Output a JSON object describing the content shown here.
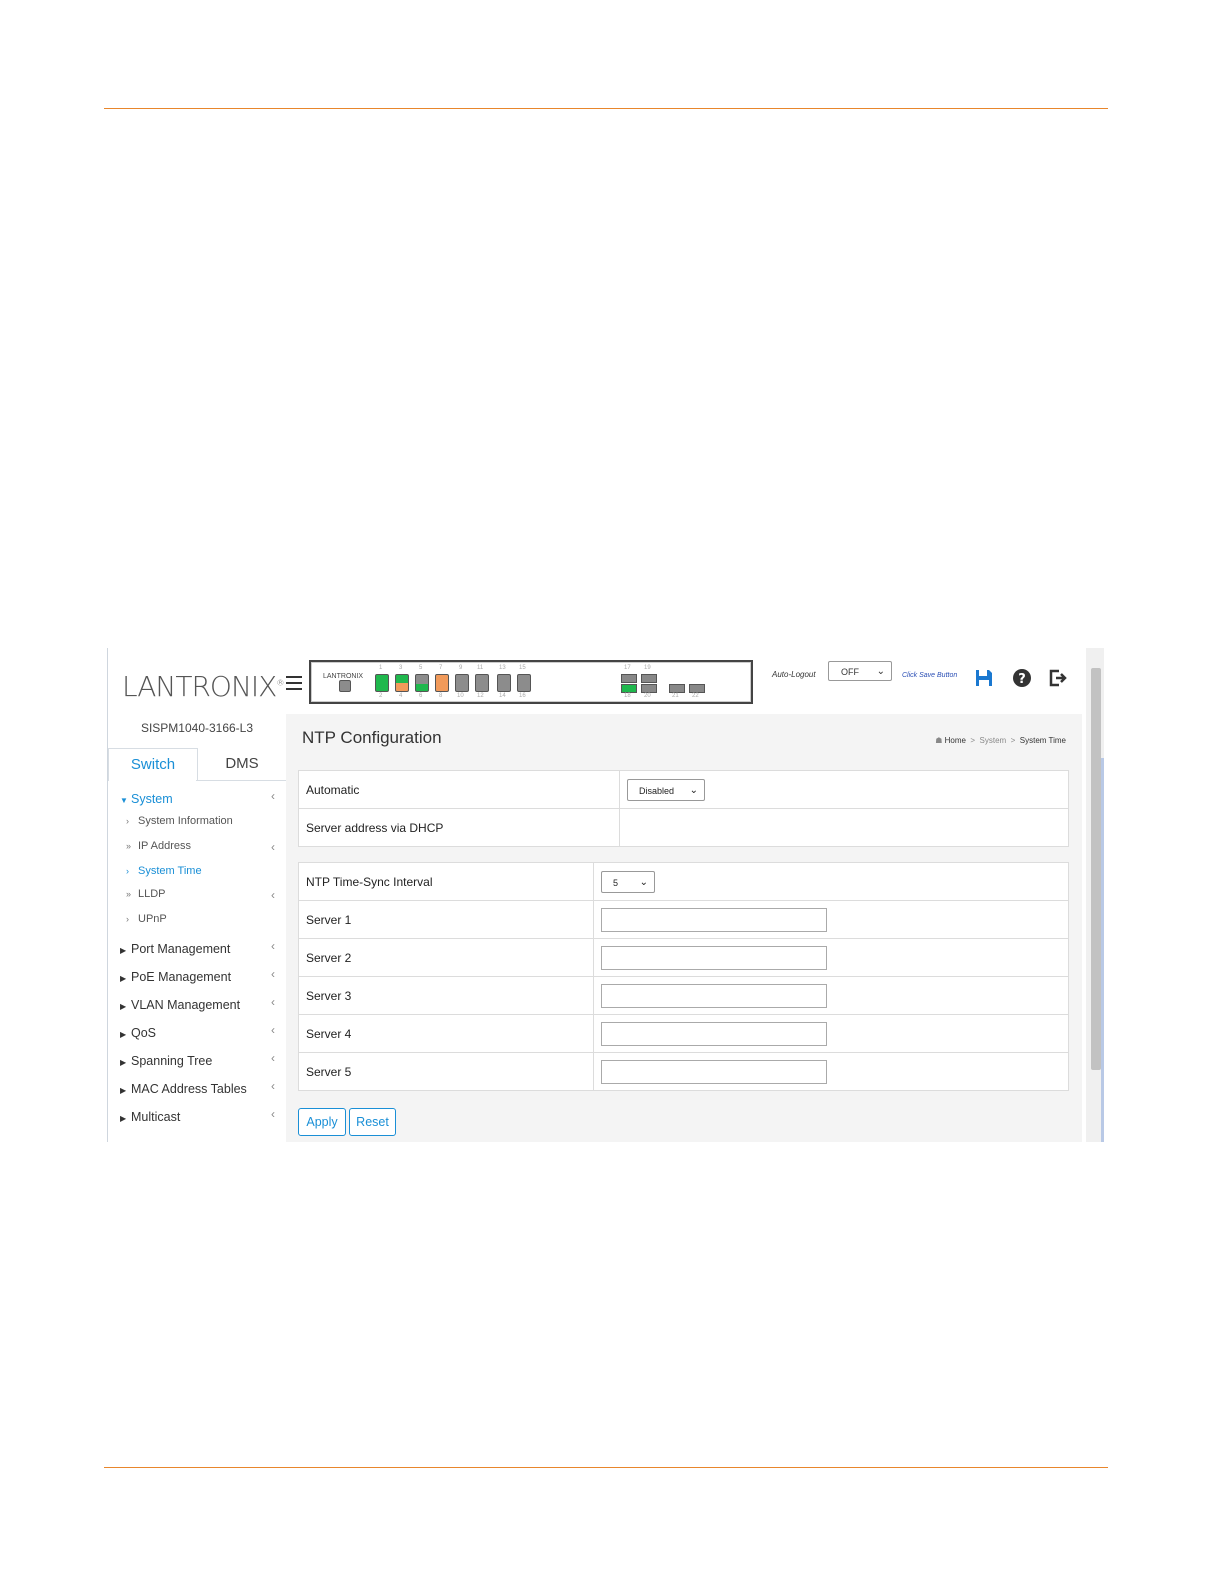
{
  "brand": {
    "logo_main": "LANTRONIX",
    "logo_mark": "®",
    "panel_brand": "LANTRONIX"
  },
  "ports": {
    "top": [
      "1",
      "3",
      "5",
      "7",
      "9",
      "11",
      "13",
      "15"
    ],
    "bottom": [
      "2",
      "4",
      "6",
      "8",
      "10",
      "12",
      "14",
      "16"
    ],
    "sfp_top": [
      "17",
      "19"
    ],
    "sfp_bottom": [
      "18",
      "20"
    ],
    "sfp_extra": [
      "21",
      "22"
    ],
    "status_colors": {
      "up": "#1fb84d",
      "poe": "#f19a5a",
      "down": "#8c8c8c"
    }
  },
  "header": {
    "auto_logout_label": "Auto-Logout",
    "auto_logout_value": "OFF",
    "save_hint": "Click Save Button",
    "icons": [
      "save-icon",
      "help-icon",
      "logout-icon"
    ]
  },
  "sidebar": {
    "model": "SISPM1040-3166-L3",
    "tabs": [
      "Switch",
      "DMS"
    ],
    "system": "System",
    "system_items": [
      "System Information",
      "IP Address",
      "System Time",
      "LLDP",
      "UPnP"
    ],
    "menu": [
      "Port Management",
      "PoE Management",
      "VLAN Management",
      "QoS",
      "Spanning Tree",
      "MAC Address Tables",
      "Multicast"
    ]
  },
  "content": {
    "title": "NTP Configuration",
    "breadcrumb": [
      "Home",
      "System",
      "System Time"
    ],
    "automatic_label": "Automatic",
    "automatic_value": "Disabled",
    "dhcp_label": "Server address via DHCP",
    "interval_label": "NTP Time-Sync Interval",
    "interval_value": "5",
    "servers": [
      "Server 1",
      "Server 2",
      "Server 3",
      "Server 4",
      "Server 5"
    ],
    "apply": "Apply",
    "reset": "Reset"
  },
  "colors": {
    "accent": "#1a8fd6",
    "rule": "#e8862c"
  }
}
